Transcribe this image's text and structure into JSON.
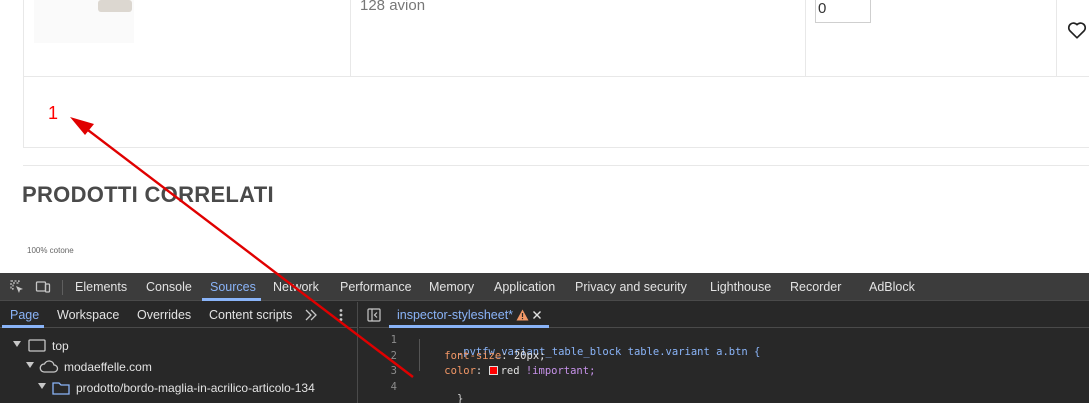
{
  "product_table": {
    "variant_name": "128 avion",
    "quantity_value": "0",
    "pagination_current": "1"
  },
  "related": {
    "title": "PRODOTTI CORRELATI",
    "first_item_caption": "100% cotone"
  },
  "devtools": {
    "main_tabs": [
      "Elements",
      "Console",
      "Sources",
      "Network",
      "Performance",
      "Memory",
      "Application",
      "Privacy and security",
      "Lighthouse",
      "Recorder",
      "AdBlock"
    ],
    "active_main_tab": "Sources",
    "navigator_tabs": [
      "Page",
      "Workspace",
      "Overrides",
      "Content scripts"
    ],
    "active_navigator_tab": "Page",
    "tree": {
      "root": "top",
      "domain": "modaeffelle.com",
      "folder": "prodotto/bordo-maglia-in-acrilico-articolo-134"
    },
    "editor_tab": "inspector-stylesheet*",
    "code": {
      "line_numbers": [
        "1",
        "2",
        "3",
        "4"
      ],
      "selector": ".pvtfw_variant_table_block table.variant a.btn {",
      "prop1_name": "font-size",
      "prop1_value": "20px;",
      "prop2_name": "color",
      "prop2_value": "red",
      "prop2_flag": "!important;",
      "closing": "}"
    }
  },
  "colors": {
    "link_red": "#ff0000",
    "devtools_accent": "#8ab4f8",
    "devtools_bg": "#282828",
    "arrow": "#e00000"
  }
}
